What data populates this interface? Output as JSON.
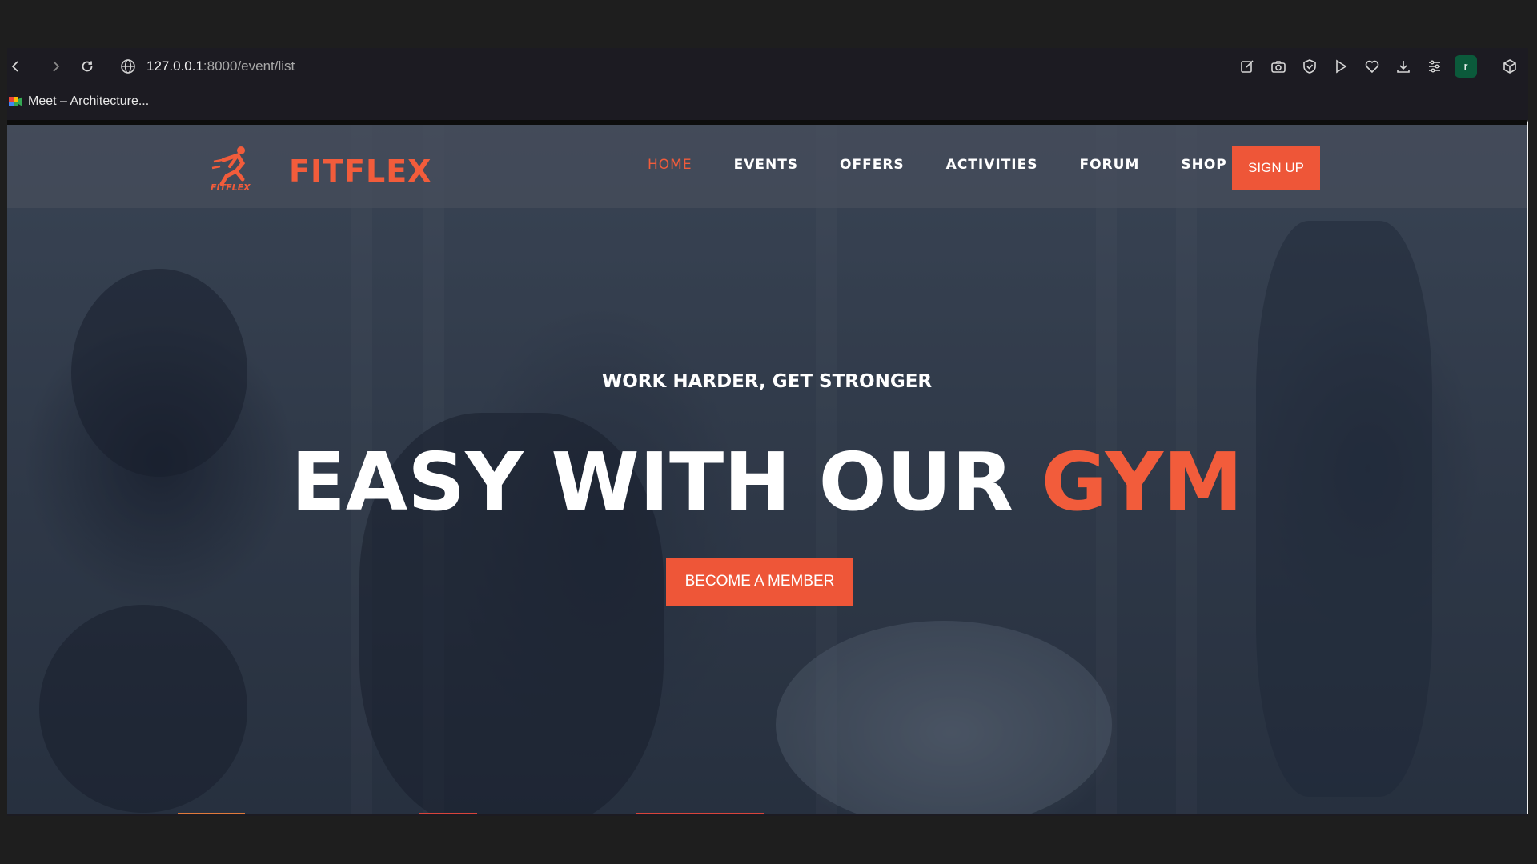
{
  "browser": {
    "url_host": "127.0.0.1",
    "url_path": ":8000/event/list",
    "profile_initial": "r",
    "bookmarks": [
      {
        "label": "Meet – Architecture..."
      }
    ]
  },
  "site": {
    "brand": "FITFLEX",
    "logo_caption": "FITFLEX",
    "nav": [
      {
        "label": "HOME",
        "active": true
      },
      {
        "label": "EVENTS"
      },
      {
        "label": "OFFERS"
      },
      {
        "label": "ACTIVITIES"
      },
      {
        "label": "FORUM"
      },
      {
        "label": "SHOP"
      }
    ],
    "signup_label": "SIGN UP",
    "accent_color": "#f25c3b"
  },
  "hero": {
    "tagline": "WORK HARDER, GET STRONGER",
    "headline_main": "EASY WITH OUR ",
    "headline_accent": "GYM",
    "cta_label": "BECOME A MEMBER"
  }
}
